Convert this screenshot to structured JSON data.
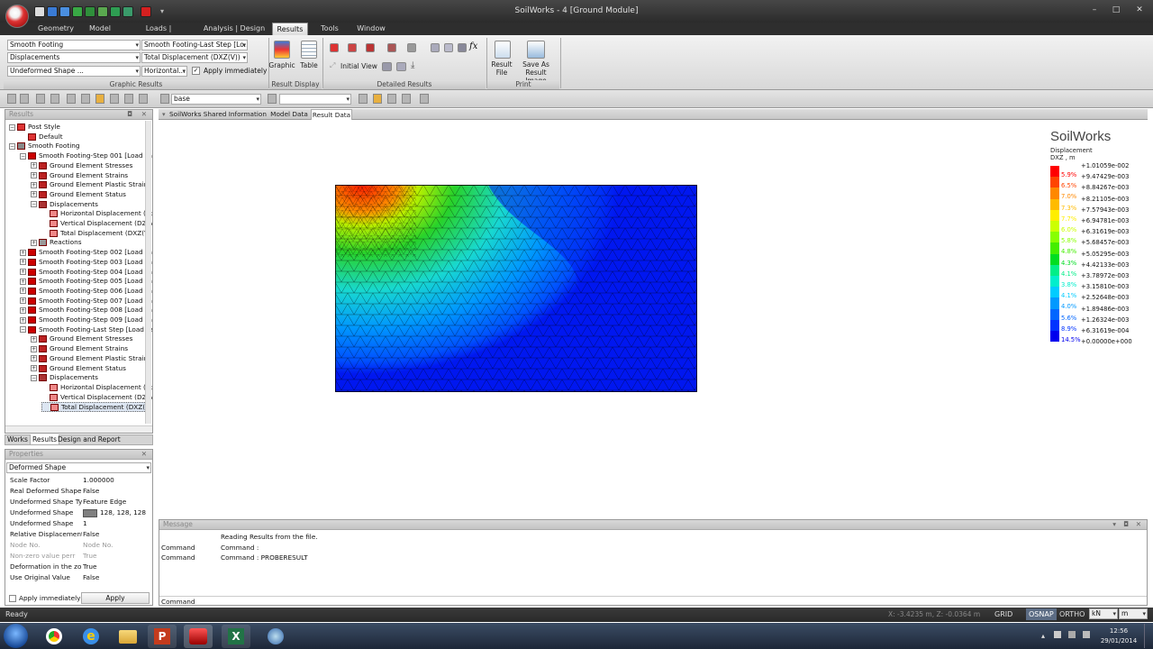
{
  "app": {
    "title": "SoilWorks - 4 [Ground Module]",
    "window_controls": [
      "–",
      "□",
      "✕"
    ]
  },
  "menu": {
    "tabs": [
      "Geometry",
      "Model",
      "Loads | Boundaries",
      "Analysis | Design",
      "Results",
      "Tools",
      "Window"
    ],
    "active": "Results"
  },
  "ribbon": {
    "graphic_results": {
      "label": "Graphic Results",
      "combo1": "Smooth Footing",
      "combo2": "Displacements",
      "combo3": "Undeformed Shape ...",
      "combo4": "Smooth Footing-Last Step [Lo...",
      "combo5": "Total Displacement (DXZ(V))",
      "combo6": "Horizontal...",
      "apply_immediately": "Apply immediately"
    },
    "result_display": {
      "label": "Result Display",
      "graphic": "Graphic",
      "table": "Table"
    },
    "detailed_results": {
      "label": "Detailed Results",
      "initial_view": "Initial View"
    },
    "print": {
      "label": "Print",
      "result_file_1": "Result",
      "result_file_2": "File",
      "save_image_1": "Save As",
      "save_image_2": "Result Image"
    }
  },
  "toolbar2": {
    "layer_value": "base"
  },
  "tree": {
    "header": "Results",
    "items": [
      {
        "label": "Post Style",
        "level": 0,
        "icon": "style-icon",
        "expanded": true
      },
      {
        "label": "Default",
        "level": 1,
        "icon": "style-icon"
      },
      {
        "label": "Smooth Footing",
        "level": 0,
        "icon": "model-icon",
        "expanded": true
      },
      {
        "label": "Smooth Footing-Step 001 [Load Fac",
        "level": 1,
        "icon": "stage-icon",
        "expanded": true
      },
      {
        "label": "Ground Element Stresses",
        "level": 2,
        "icon": "result-icon",
        "expanded": false
      },
      {
        "label": "Ground Element Strains",
        "level": 2,
        "icon": "result-icon",
        "expanded": false
      },
      {
        "label": "Ground Element Plastic Strains",
        "level": 2,
        "icon": "result-icon",
        "expanded": false
      },
      {
        "label": "Ground Element Status",
        "level": 2,
        "icon": "result-icon",
        "expanded": false
      },
      {
        "label": "Displacements",
        "level": 2,
        "icon": "displacement-icon",
        "expanded": true
      },
      {
        "label": "Horizontal Displacement (D:",
        "level": 3,
        "icon": "contour-icon"
      },
      {
        "label": "Vertical Displacement (DZ(V",
        "level": 3,
        "icon": "contour-icon"
      },
      {
        "label": "Total Displacement (DXZ(V",
        "level": 3,
        "icon": "contour-icon"
      },
      {
        "label": "Reactions",
        "level": 2,
        "icon": "reaction-icon",
        "expanded": false
      },
      {
        "label": "Smooth Footing-Step 002 [Load Fac",
        "level": 1,
        "icon": "stage-icon",
        "expanded": false
      },
      {
        "label": "Smooth Footing-Step 003 [Load Fac",
        "level": 1,
        "icon": "stage-icon",
        "expanded": false
      },
      {
        "label": "Smooth Footing-Step 004 [Load Fac",
        "level": 1,
        "icon": "stage-icon",
        "expanded": false
      },
      {
        "label": "Smooth Footing-Step 005 [Load Fac",
        "level": 1,
        "icon": "stage-icon",
        "expanded": false
      },
      {
        "label": "Smooth Footing-Step 006 [Load Fac",
        "level": 1,
        "icon": "stage-icon",
        "expanded": false
      },
      {
        "label": "Smooth Footing-Step 007 [Load Fac",
        "level": 1,
        "icon": "stage-icon",
        "expanded": false
      },
      {
        "label": "Smooth Footing-Step 008 [Load Fac",
        "level": 1,
        "icon": "stage-icon",
        "expanded": false
      },
      {
        "label": "Smooth Footing-Step 009 [Load Fac",
        "level": 1,
        "icon": "stage-icon",
        "expanded": false
      },
      {
        "label": "Smooth Footing-Last Step [Load Fa",
        "level": 1,
        "icon": "stage-icon",
        "expanded": true
      },
      {
        "label": "Ground Element Stresses",
        "level": 2,
        "icon": "result-icon",
        "expanded": false
      },
      {
        "label": "Ground Element Strains",
        "level": 2,
        "icon": "result-icon",
        "expanded": false
      },
      {
        "label": "Ground Element Plastic Strains",
        "level": 2,
        "icon": "result-icon",
        "expanded": false
      },
      {
        "label": "Ground Element Status",
        "level": 2,
        "icon": "result-icon",
        "expanded": false
      },
      {
        "label": "Displacements",
        "level": 2,
        "icon": "displacement-icon",
        "expanded": true
      },
      {
        "label": "Horizontal Displacement (D:",
        "level": 3,
        "icon": "contour-icon"
      },
      {
        "label": "Vertical Displacement (DZ(V",
        "level": 3,
        "icon": "contour-icon"
      },
      {
        "label": "Total Displacement (DXZ(V",
        "level": 3,
        "icon": "contour-icon",
        "selected": true
      }
    ],
    "bottom_tabs": [
      "Works",
      "Results",
      "Design and Report"
    ]
  },
  "properties": {
    "header": "Properties",
    "selector": "Deformed Shape",
    "rows": [
      {
        "name": "Scale Factor",
        "value": "1.000000"
      },
      {
        "name": "Real Deformed Shape",
        "value": "False"
      },
      {
        "name": "Undeformed Shape Ty",
        "value": "Feature Edge"
      },
      {
        "name": "Undeformed Shape",
        "value": "128, 128, 128",
        "swatch": "#808080"
      },
      {
        "name": "Undeformed Shape",
        "value": "1"
      },
      {
        "name": "Relative Displacement",
        "value": "False"
      },
      {
        "name": "Node No.",
        "value": "Node No.",
        "disabled": true
      },
      {
        "name": "Non-zero value perr",
        "value": "True",
        "disabled": true
      },
      {
        "name": "Deformation in the zo",
        "value": "True"
      },
      {
        "name": "Use Original Value",
        "value": "False"
      }
    ],
    "apply_immediately": "Apply immediately",
    "apply": "Apply"
  },
  "doc_tabs": [
    "SoilWorks Shared Information",
    "Model Data",
    "Result Data"
  ],
  "doc_tab_active": "Result Data",
  "legend": {
    "brand": "SoilWorks",
    "title": "Displacement",
    "unit_label": "DXZ , m",
    "values": [
      "+1.01059e-002",
      "+9.47429e-003",
      "+8.84267e-003",
      "+8.21105e-003",
      "+7.57943e-003",
      "+6.94781e-003",
      "+6.31619e-003",
      "+5.68457e-003",
      "+5.05295e-003",
      "+4.42133e-003",
      "+3.78972e-003",
      "+3.15810e-003",
      "+2.52648e-003",
      "+1.89486e-003",
      "+1.26324e-003",
      "+6.31619e-004",
      "+0.00000e+000"
    ],
    "percents": [
      "5.9%",
      "6.5%",
      "7.0%",
      "7.3%",
      "7.7%",
      "6.0%",
      "5.8%",
      "4.8%",
      "4.3%",
      "4.1%",
      "3.8%",
      "4.1%",
      "4.0%",
      "5.6%",
      "8.9%",
      "14.5%"
    ],
    "colors": [
      "#ff0000",
      "#ff4400",
      "#ff8800",
      "#ffbb00",
      "#ffee00",
      "#ccff00",
      "#88ff00",
      "#44ee00",
      "#00dd22",
      "#00ee88",
      "#00eecc",
      "#00ccff",
      "#0099ff",
      "#0066ff",
      "#0033ff",
      "#0000ee"
    ]
  },
  "messages": {
    "header": "Message",
    "rows": [
      {
        "col1": "",
        "col2": "Reading Results from the file."
      },
      {
        "col1": "Command",
        "col2": "Command :"
      },
      {
        "col1": "Command",
        "col2": "Command : PROBERESULT"
      }
    ],
    "prompt": "Command"
  },
  "status": {
    "ready": "Ready",
    "coords": "X: -3.4235 m, Z: -0.0364 m",
    "grid": "GRID",
    "osnap": "OSNAP",
    "ortho": "ORTHO",
    "force_unit": "kN",
    "length_unit": "m"
  },
  "taskbar": {
    "time": "12:56",
    "date": "29/01/2014"
  }
}
